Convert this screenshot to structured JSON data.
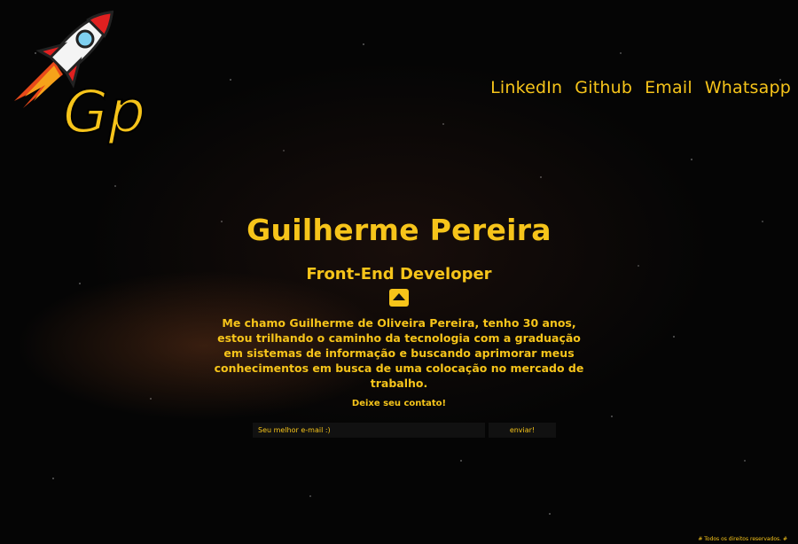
{
  "logo": {
    "text": "Gp"
  },
  "nav": {
    "links": [
      {
        "label": "LinkedIn"
      },
      {
        "label": "Github"
      },
      {
        "label": "Email"
      },
      {
        "label": "Whatsapp"
      }
    ]
  },
  "hero": {
    "name": "Guilherme Pereira",
    "role": "Front-End Developer",
    "bio": "Me chamo Guilherme de Oliveira Pereira, tenho 30 anos, estou trilhando o caminho da tecnologia com a graduação em sistemas de informação e buscando aprimorar meus conhecimentos em busca de uma colocação no mercado de trabalho."
  },
  "contact": {
    "title": "Deixe seu contato!",
    "email_placeholder": "Seu melhor e-mail :)",
    "send_label": "enviar!"
  },
  "footer": {
    "text": "# Todos os direitos reservados. #"
  },
  "colors": {
    "accent": "#f6c41a",
    "background": "#050505"
  }
}
